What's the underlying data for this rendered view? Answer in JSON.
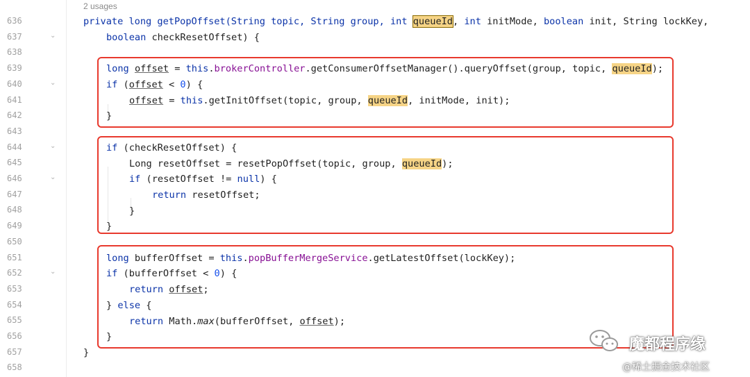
{
  "editor": {
    "usages_hint": "2 usages",
    "line_numbers": [
      "636",
      "637",
      "638",
      "639",
      "640",
      "641",
      "642",
      "643",
      "644",
      "645",
      "646",
      "647",
      "648",
      "649",
      "650",
      "651",
      "652",
      "653",
      "654",
      "655",
      "656",
      "657",
      "658"
    ],
    "fold_marker_lines": [
      "637",
      "640",
      "644",
      "646",
      "652"
    ],
    "fold_glyph": "⌄"
  },
  "code": {
    "l636": {
      "t1": "private long getPopOffset(String topic, String group, ",
      "t2": "int",
      "t3": " ",
      "t4": "queueId",
      "t5": ", ",
      "t6": "int",
      "t7": " initMode, ",
      "t8": "boolean",
      "t9": " init, String lockKey,"
    },
    "l637": {
      "t1": "boolean",
      "t2": " checkResetOffset) {"
    },
    "l639": {
      "t1": "long",
      "t2": " ",
      "t3": "offset",
      "t4": " = ",
      "t5": "this",
      "t6": ".",
      "t7": "brokerController",
      "t8": ".getConsumerOffsetManager().queryOffset(group, topic, ",
      "t9": "queueId",
      "t10": ");"
    },
    "l640": {
      "t1": "if",
      "t2": " (",
      "t3": "offset",
      "t4": " < ",
      "t5": "0",
      "t6": ") {"
    },
    "l641": {
      "t1": "offset",
      "t2": " = ",
      "t3": "this",
      "t4": ".getInitOffset(topic, group, ",
      "t5": "queueId",
      "t6": ", initMode, init);"
    },
    "l642": {
      "t1": "}"
    },
    "l644": {
      "t1": "if",
      "t2": " (checkResetOffset) {"
    },
    "l645": {
      "t1": "Long resetOffset = resetPopOffset(topic, group, ",
      "t2": "queueId",
      "t3": ");"
    },
    "l646": {
      "t1": "if",
      "t2": " (resetOffset != ",
      "t3": "null",
      "t4": ") {"
    },
    "l647": {
      "t1": "return",
      "t2": " resetOffset;"
    },
    "l648": {
      "t1": "}"
    },
    "l649": {
      "t1": "}"
    },
    "l651": {
      "t1": "long",
      "t2": " bufferOffset = ",
      "t3": "this",
      "t4": ".",
      "t5": "popBufferMergeService",
      "t6": ".getLatestOffset(lockKey);"
    },
    "l652": {
      "t1": "if",
      "t2": " (bufferOffset < ",
      "t3": "0",
      "t4": ") {"
    },
    "l653": {
      "t1": "return",
      "t2": " ",
      "t3": "offset",
      "t4": ";"
    },
    "l654": {
      "t1": "} ",
      "t2": "else",
      "t3": " {"
    },
    "l655": {
      "t1": "return",
      "t2": " Math.",
      "t3": "max",
      "t4": "(bufferOffset, ",
      "t5": "offset",
      "t6": ");"
    },
    "l656": {
      "t1": "}"
    },
    "l657": {
      "t1": "}"
    }
  },
  "watermark": {
    "title": "魔都程序缘",
    "subtitle": "@稀土掘金技术社区"
  },
  "colors": {
    "keyword": "#0b33a8",
    "field": "#871094",
    "number": "#1750eb",
    "highlight": "#f6d486",
    "annotation_box": "#e8392d"
  }
}
